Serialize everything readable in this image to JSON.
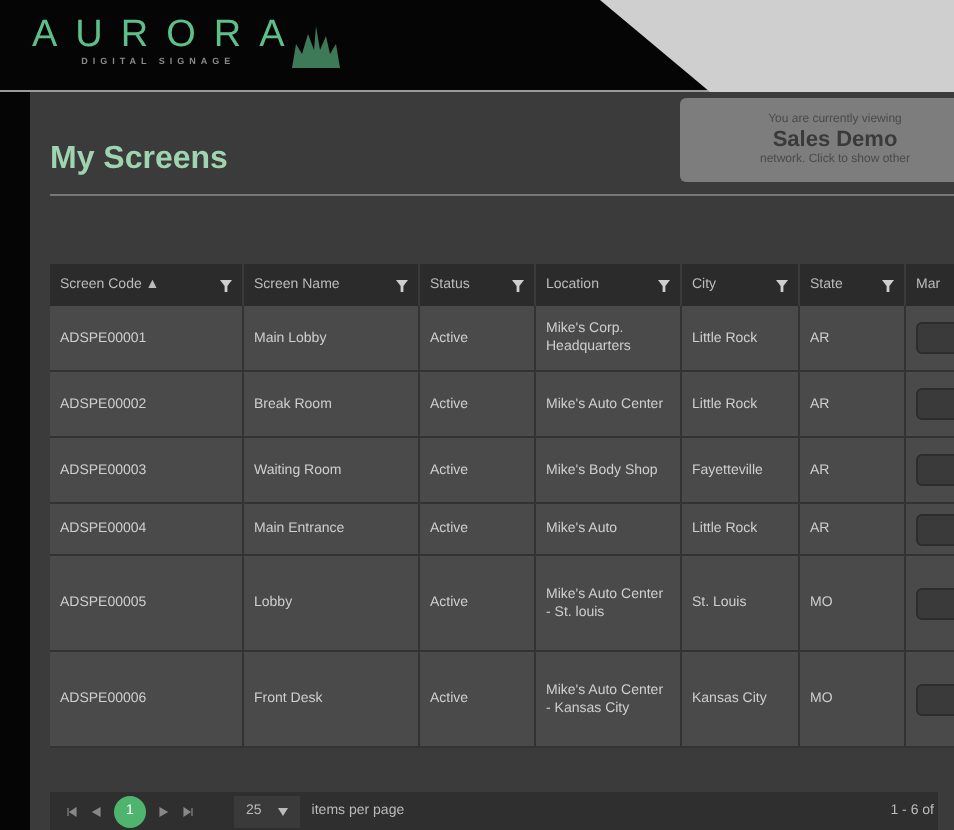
{
  "logo": {
    "name": "AURORA",
    "tagline": "DIGITAL SIGNAGE"
  },
  "page": {
    "title": "My Screens"
  },
  "network_notice": {
    "line_1": "You are currently viewing",
    "network": "Sales Demo",
    "line_2": "network. Click to show other"
  },
  "table": {
    "columns": [
      {
        "label": "Screen Code",
        "sort": "▲",
        "filter": true
      },
      {
        "label": "Screen Name",
        "filter": true
      },
      {
        "label": "Status",
        "filter": true
      },
      {
        "label": "Location",
        "filter": true
      },
      {
        "label": "City",
        "filter": true
      },
      {
        "label": "State",
        "filter": true
      },
      {
        "label": "Mar"
      }
    ],
    "rows": [
      {
        "cells": [
          "ADSPE00001",
          "Main Lobby",
          "Active",
          "Mike's Corp. Headquarters",
          "Little Rock",
          "AR"
        ]
      },
      {
        "cells": [
          "ADSPE00002",
          "Break Room",
          "Active",
          "Mike's Auto Center",
          "Little Rock",
          "AR"
        ]
      },
      {
        "cells": [
          "ADSPE00003",
          "Waiting Room",
          "Active",
          "Mike's Body Shop",
          "Fayetteville",
          "AR"
        ]
      },
      {
        "cells": [
          "ADSPE00004",
          "Main Entrance",
          "Active",
          "Mike's Auto",
          "Little Rock",
          "AR"
        ]
      },
      {
        "cells": [
          "ADSPE00005",
          "Lobby",
          "Active",
          "Mike's Auto Center - St. louis",
          "St. Louis",
          "MO"
        ]
      },
      {
        "cells": [
          "ADSPE00006",
          "Front Desk",
          "Active",
          "Mike's Auto Center - Kansas City",
          "Kansas City",
          "MO"
        ]
      }
    ]
  },
  "pager": {
    "pages": [
      {
        "label": "1",
        "selected": true
      }
    ],
    "page_size": "25",
    "page_size_label": "items per page",
    "summary": "1 - 6 of"
  }
}
